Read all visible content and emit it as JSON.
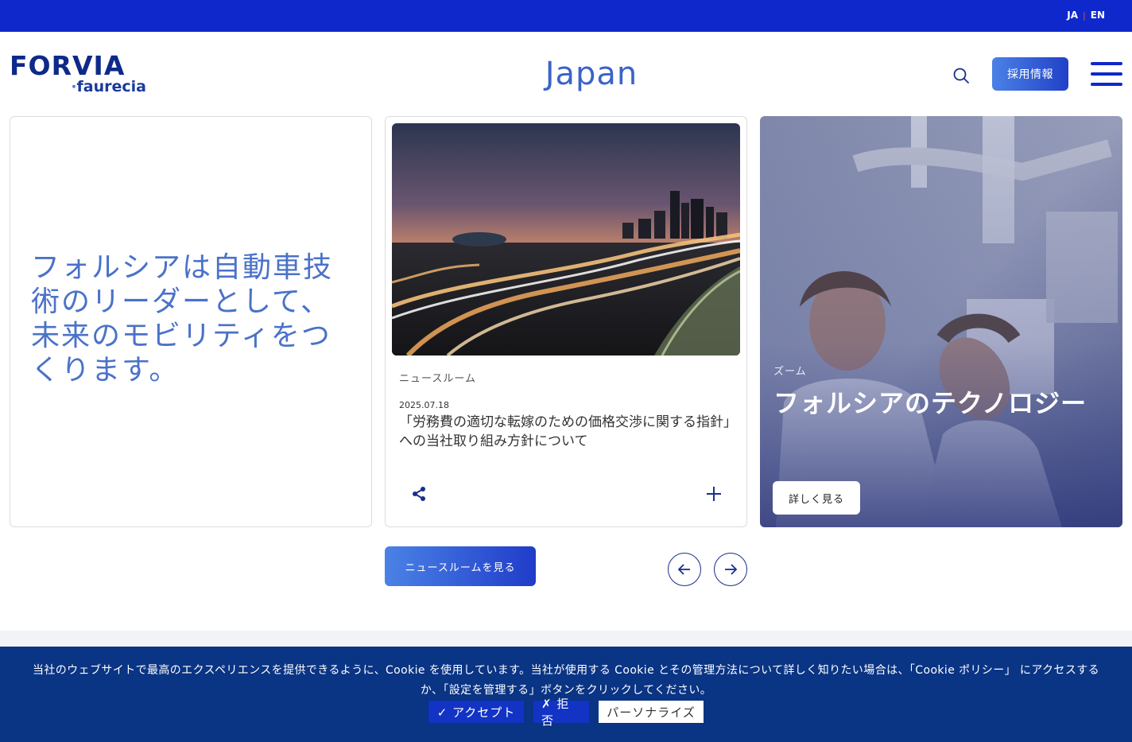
{
  "lang_switch": {
    "ja": "JA",
    "separator": "|",
    "en": "EN"
  },
  "logo": {
    "brand": "FORVIA",
    "sub_dot": "·",
    "sub": "faurecia"
  },
  "site_title": "Japan",
  "header": {
    "search_icon": "search-icon",
    "recruit_label": "採用情報",
    "menu_icon": "hamburger-menu-icon"
  },
  "tagline": "フォルシアは自動車技術のリーダーとして、未来のモビリティをつくります。",
  "news_card": {
    "category": "ニュースルーム",
    "date": "2025.07.18",
    "headline": "「労務費の適切な転嫁のための価格交渉に関する指針」への当社取り組み方針について",
    "share_icon": "share-icon",
    "expand_icon": "plus-icon"
  },
  "zoom_card": {
    "label": "ズーム",
    "title": "フォルシアのテクノロジー",
    "button": "詳しく見る"
  },
  "newsroom_button": "ニュースルームを見る",
  "carousel": {
    "prev_icon": "arrow-left-icon",
    "next_icon": "arrow-right-icon"
  },
  "cookie": {
    "message": "当社のウェブサイトで最高のエクスペリエンスを提供できるように、Cookie を使用しています。当社が使用する Cookie とその管理方法について詳しく知りたい場合は、「Cookie ポリシー」 にアクセスするか、「設定を管理する」ボタンをクリックしてください。",
    "accept": "✓ アクセプト",
    "deny": "✗ 拒否",
    "personalize": "パーソナライズ"
  },
  "colors": {
    "top_bar": "#0f28cc",
    "brand_navy": "#0d2a8a",
    "accent_blue": "#3b63c9",
    "cookie_bg": "#0a3484"
  }
}
